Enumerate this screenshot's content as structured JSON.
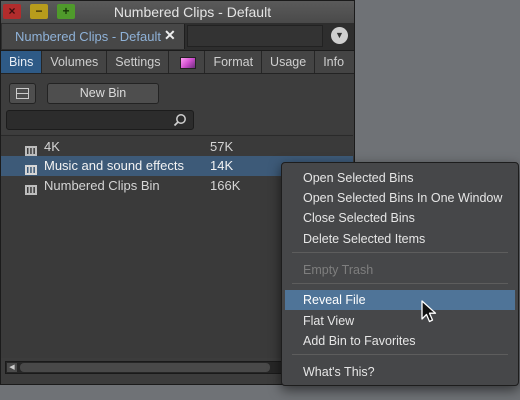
{
  "window": {
    "title": "Numbered Clips - Default",
    "buttons": {
      "close": "×",
      "minimize": "−",
      "zoom": "+"
    }
  },
  "doc_tab": {
    "label": "Numbered Clips - Default",
    "close": "✕"
  },
  "tabs": [
    "Bins",
    "Volumes",
    "Settings",
    "",
    "Format",
    "Usage",
    "Info"
  ],
  "active_tab": "Bins",
  "toolbar": {
    "new_bin_label": "New Bin"
  },
  "bins": [
    {
      "name": "4K",
      "size": "57K",
      "selected": false
    },
    {
      "name": "Music and sound effects",
      "size": "14K",
      "selected": true
    },
    {
      "name": "Numbered Clips Bin",
      "size": "166K",
      "selected": false
    }
  ],
  "context_menu": {
    "items": [
      {
        "label": "Open Selected Bins",
        "state": "normal"
      },
      {
        "label": "Open Selected Bins In One Window",
        "state": "normal"
      },
      {
        "label": "Close Selected Bins",
        "state": "normal"
      },
      {
        "label": "Delete Selected Items",
        "state": "normal"
      },
      {
        "label": "Empty Trash",
        "state": "disabled"
      },
      {
        "label": "Reveal File",
        "state": "highlighted"
      },
      {
        "label": "Flat View",
        "state": "normal"
      },
      {
        "label": "Add Bin to Favorites",
        "state": "normal"
      },
      {
        "label": "What's This?",
        "state": "normal"
      }
    ]
  },
  "colors": {
    "selection": "#3d5a78",
    "active_tab": "#2e5a86",
    "menu_highlight": "#4f7498",
    "doc_tab_text": "#8fb2d8"
  },
  "icons": {
    "search": "search-icon",
    "bin": "bin-icon",
    "view_toggle": "view-toggle-icon",
    "panel_menu": "panel-menu-icon",
    "color_tab": "color-swatch-icon",
    "cursor": "mouse-pointer-icon"
  }
}
